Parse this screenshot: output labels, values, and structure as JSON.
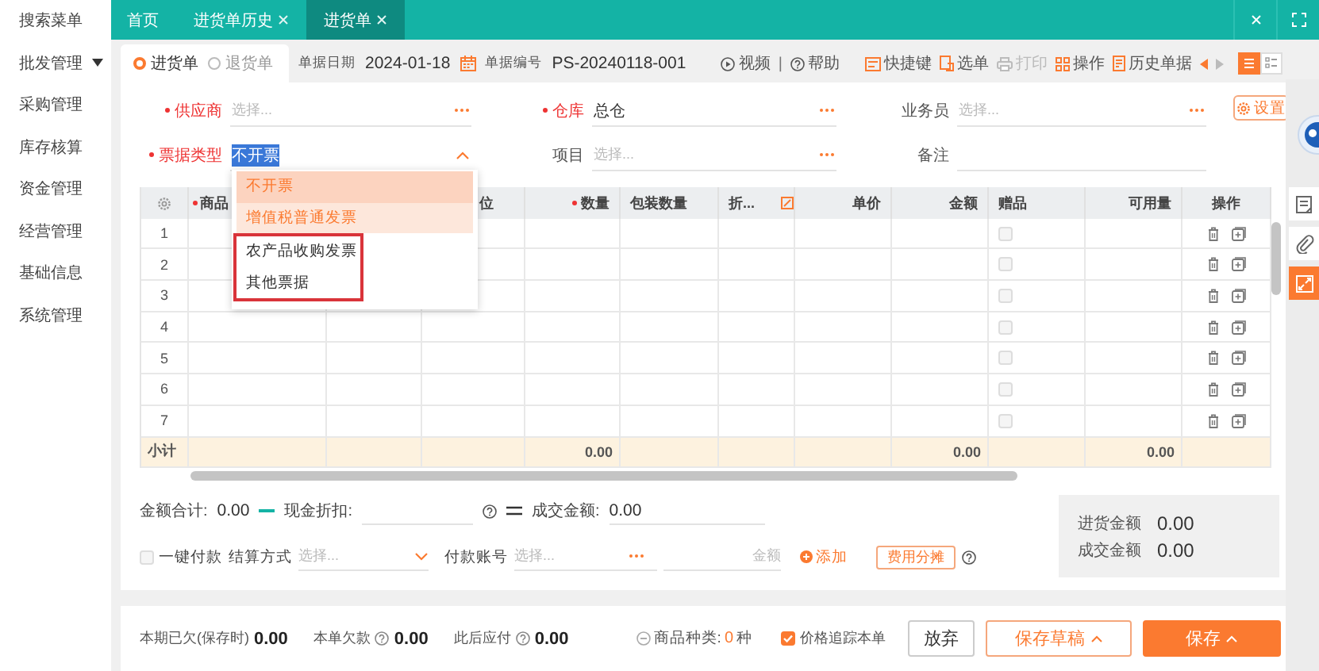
{
  "sidebar": {
    "items": [
      {
        "label": "搜索菜单",
        "expandable": false
      },
      {
        "label": "批发管理",
        "expandable": true
      },
      {
        "label": "采购管理",
        "expandable": false
      },
      {
        "label": "库存核算",
        "expandable": false
      },
      {
        "label": "资金管理",
        "expandable": false
      },
      {
        "label": "经营管理",
        "expandable": false
      },
      {
        "label": "基础信息",
        "expandable": false
      },
      {
        "label": "系统管理",
        "expandable": false
      }
    ]
  },
  "tabs": [
    {
      "label": "首页",
      "closable": false,
      "selected": false
    },
    {
      "label": "进货单历史",
      "closable": true,
      "selected": false
    },
    {
      "label": "进货单",
      "closable": true,
      "selected": true
    }
  ],
  "doc_type": [
    {
      "label": "进货单",
      "selected": true
    },
    {
      "label": "退货单",
      "selected": false
    }
  ],
  "header_fields": [
    {
      "label": "单据日期",
      "value": "2024-01-18",
      "kind": "date"
    },
    {
      "label": "单据编号",
      "value": "PS-20240118-001",
      "kind": "text"
    }
  ],
  "toolbar": [
    {
      "label": "视频",
      "kind": "video",
      "disabled": false
    },
    {
      "label": "|",
      "kind": "separator"
    },
    {
      "label": "帮助",
      "kind": "help",
      "disabled": false
    },
    {
      "label": "快捷键",
      "kind": "keyboard",
      "disabled": false
    },
    {
      "label": "选单",
      "kind": "pick",
      "disabled": false
    },
    {
      "label": "打印",
      "kind": "print",
      "disabled": true
    },
    {
      "label": "操作",
      "kind": "grid",
      "disabled": false
    },
    {
      "label": "历史单据",
      "kind": "history",
      "disabled": false
    }
  ],
  "view_toggle": [
    {
      "kind": "list",
      "selected": true
    },
    {
      "kind": "detail",
      "selected": false
    }
  ],
  "form": {
    "rows": [
      [
        {
          "label": "供应商",
          "required": true,
          "placeholder": "选择...",
          "kind": "picker"
        },
        {
          "label": "仓库",
          "required": true,
          "value": "总仓",
          "kind": "picker"
        },
        {
          "label": "业务员",
          "required": false,
          "placeholder": "选择...",
          "kind": "picker"
        }
      ],
      [
        {
          "label": "票据类型",
          "required": true,
          "value": "不开票",
          "kind": "select",
          "open": true
        },
        {
          "label": "项目",
          "required": false,
          "placeholder": "选择...",
          "kind": "picker"
        },
        {
          "label": "备注",
          "required": false,
          "kind": "text"
        }
      ]
    ],
    "settings_button": "设置"
  },
  "invoice_dropdown": {
    "options": [
      {
        "label": "不开票",
        "selected": true,
        "hovered": false,
        "annotated": false
      },
      {
        "label": "增值税普通发票",
        "selected": false,
        "hovered": true,
        "annotated": false
      },
      {
        "label": "农产品收购发票",
        "selected": false,
        "hovered": false,
        "annotated": true
      },
      {
        "label": "其他票据",
        "selected": false,
        "hovered": false,
        "annotated": true
      }
    ]
  },
  "table": {
    "subtotal_label": "小计",
    "columns": [
      {
        "kind": "index",
        "required": false,
        "editable": false
      },
      {
        "kind": "text",
        "label": "商品",
        "required": true,
        "editable": false
      },
      {
        "kind": "text"
      },
      {
        "kind": "text",
        "label": "位",
        "required": false,
        "editable": false
      },
      {
        "kind": "number",
        "label": "数量",
        "required": true,
        "editable": false,
        "subtotal": "0.00"
      },
      {
        "kind": "text",
        "label": "包装数量",
        "required": false,
        "editable": false
      },
      {
        "kind": "text",
        "label": "折...",
        "required": false,
        "editable": true
      },
      {
        "kind": "number",
        "label": "单价",
        "required": false,
        "editable": false
      },
      {
        "kind": "number",
        "label": "金额",
        "required": false,
        "editable": false,
        "subtotal": "0.00"
      },
      {
        "kind": "gift",
        "label": "赠品",
        "required": false,
        "editable": false
      },
      {
        "kind": "number",
        "label": "可用量",
        "required": false,
        "editable": false,
        "subtotal": "0.00"
      },
      {
        "kind": "actions",
        "label": "操作",
        "required": false,
        "editable": false
      }
    ],
    "rows": [
      {
        "index": "1",
        "gift": false
      },
      {
        "index": "2",
        "gift": false
      },
      {
        "index": "3",
        "gift": false
      },
      {
        "index": "4",
        "gift": false
      },
      {
        "index": "5",
        "gift": false
      },
      {
        "index": "6",
        "gift": false
      },
      {
        "index": "7",
        "gift": false
      }
    ]
  },
  "totals": {
    "amount_total": {
      "label": "金额合计:",
      "value": "0.00"
    },
    "cash_discount": {
      "label": "现金折扣:"
    },
    "deal_amount": {
      "label": "成交金额:",
      "value": "0.00"
    }
  },
  "payment": {
    "one_click": {
      "label": "一键付款",
      "checked": false
    },
    "method": {
      "label": "结算方式",
      "placeholder": "选择..."
    },
    "account": {
      "label": "付款账号",
      "placeholder": "选择..."
    },
    "amount": {
      "placeholder": "金额"
    },
    "add": "添加",
    "allocate": "费用分摊"
  },
  "summary": [
    {
      "label": "进货金额",
      "value": "0.00"
    },
    {
      "label": "成交金额",
      "value": "0.00"
    }
  ],
  "footer": {
    "stats": [
      {
        "label": "本期已欠(保存时)",
        "value": "0.00",
        "help": false
      },
      {
        "label": "本单欠款",
        "value": "0.00",
        "help": true
      },
      {
        "label": "此后应付",
        "value": "0.00",
        "help": true
      }
    ],
    "item_types": {
      "label": "商品种类:",
      "value": "0",
      "unit": "种"
    },
    "price_track": {
      "label": "价格追踪本单",
      "checked": true
    },
    "buttons": [
      {
        "label": "放弃",
        "kind": "plain",
        "has_menu": false
      },
      {
        "label": "保存草稿",
        "kind": "outline",
        "has_menu": true
      },
      {
        "label": "保存",
        "kind": "primary",
        "has_menu": true
      }
    ]
  },
  "rail": [
    {
      "kind": "float-ball"
    },
    {
      "kind": "note",
      "selected": false
    },
    {
      "kind": "clip",
      "selected": false
    },
    {
      "kind": "expand",
      "selected": true
    }
  ]
}
